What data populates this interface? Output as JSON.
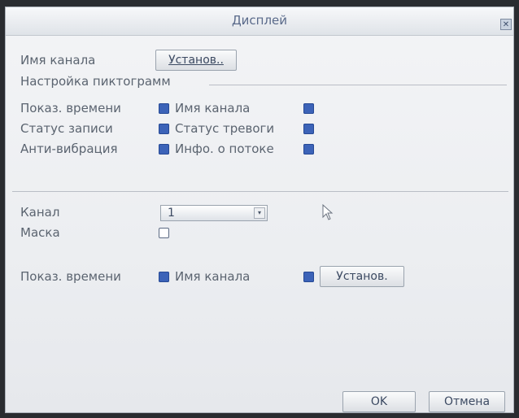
{
  "window": {
    "title": "Дисплей",
    "close_glyph": "✕"
  },
  "channel_name": {
    "label": "Имя канала",
    "button": "Установ.."
  },
  "icon_settings": {
    "header": "Настройка пиктограмм",
    "items": [
      {
        "label": "Показ. времени",
        "checked": true
      },
      {
        "label": "Имя канала",
        "checked": true
      },
      {
        "label": "Статус записи",
        "checked": true
      },
      {
        "label": "Статус тревоги",
        "checked": true
      },
      {
        "label": "Анти-вибрация",
        "checked": true
      },
      {
        "label": "Инфо. о потоке",
        "checked": true
      }
    ]
  },
  "channel": {
    "label": "Канал",
    "value": "1",
    "arrow_glyph": "▾"
  },
  "mask": {
    "label": "Маска",
    "checked": false
  },
  "overlay": {
    "show_time_label": "Показ. времени",
    "show_time_checked": true,
    "channel_name_label": "Имя канала",
    "channel_name_checked": true,
    "button": "Установ."
  },
  "footer": {
    "ok": "OK",
    "cancel": "Отмена"
  },
  "colors": {
    "checkbox_checked": "#3c63b8",
    "title_text": "#5a6a8a",
    "label_text": "#5b6470"
  }
}
